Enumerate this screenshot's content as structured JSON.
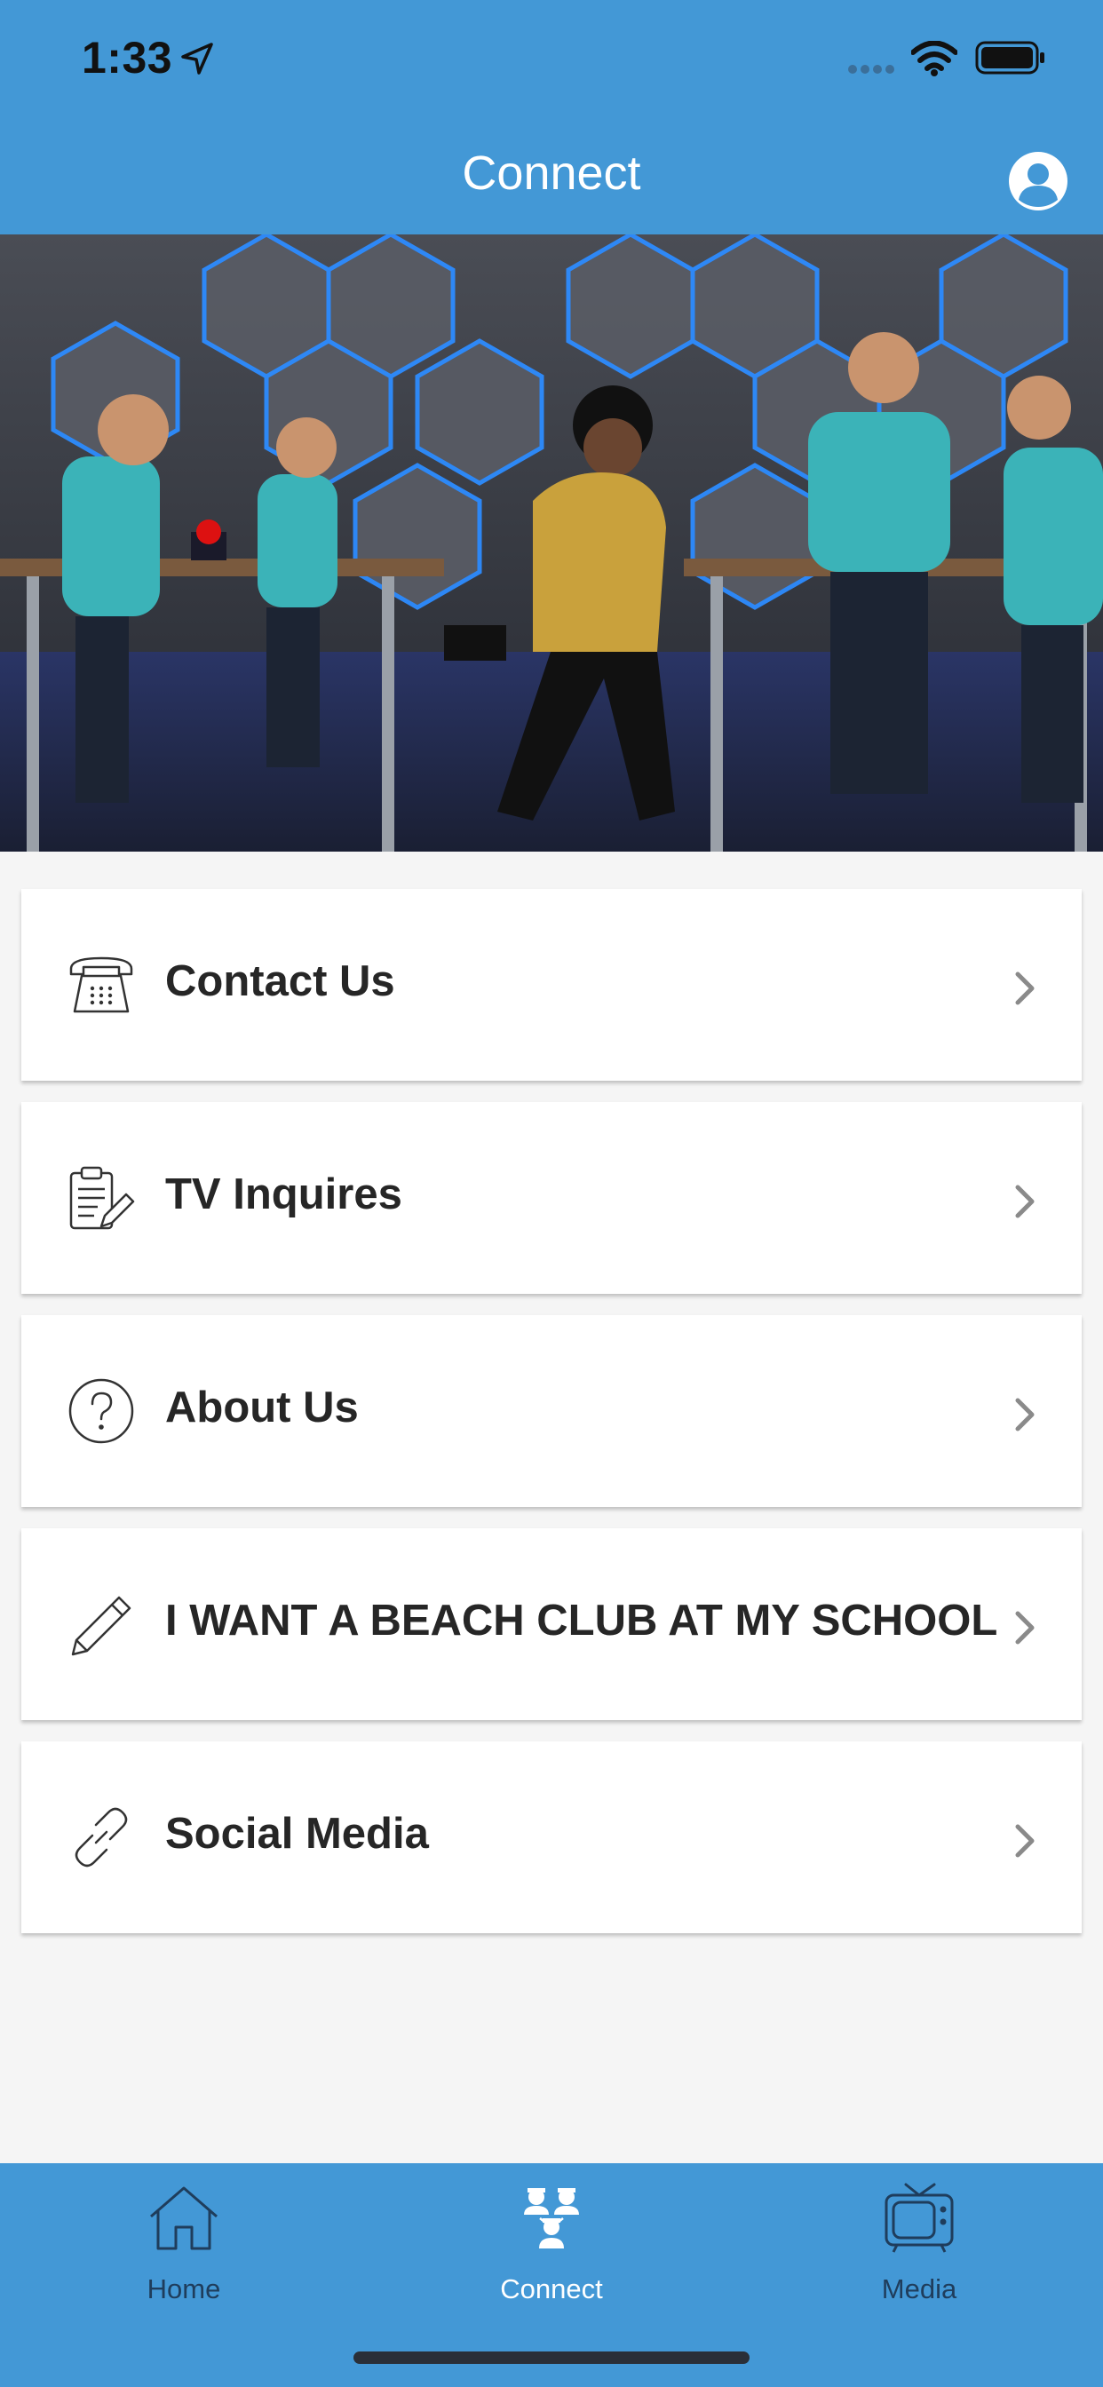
{
  "status_bar": {
    "time": "1:33"
  },
  "nav": {
    "title": "Connect",
    "profile_icon": "user-circle-icon"
  },
  "hero": {
    "image": "game-show-stage-photo"
  },
  "menu": [
    {
      "label": "Contact Us",
      "icon": "telephone-icon"
    },
    {
      "label": "TV Inquires",
      "icon": "clipboard-edit-icon"
    },
    {
      "label": "About Us",
      "icon": "question-circle-icon"
    },
    {
      "label": "I WANT A BEACH CLUB AT MY SCHOOL",
      "icon": "pencil-icon"
    },
    {
      "label": "Social Media",
      "icon": "link-icon"
    }
  ],
  "tabs": [
    {
      "label": "Home",
      "icon": "house-icon",
      "selected": false
    },
    {
      "label": "Connect",
      "icon": "people-icon",
      "selected": true
    },
    {
      "label": "Media",
      "icon": "tv-icon",
      "selected": false
    }
  ],
  "colors": {
    "brand_blue": "#4398d6",
    "tab_selected": "#ffffff",
    "tab_unselected": "#1f3d5c",
    "card_text": "#262626"
  }
}
